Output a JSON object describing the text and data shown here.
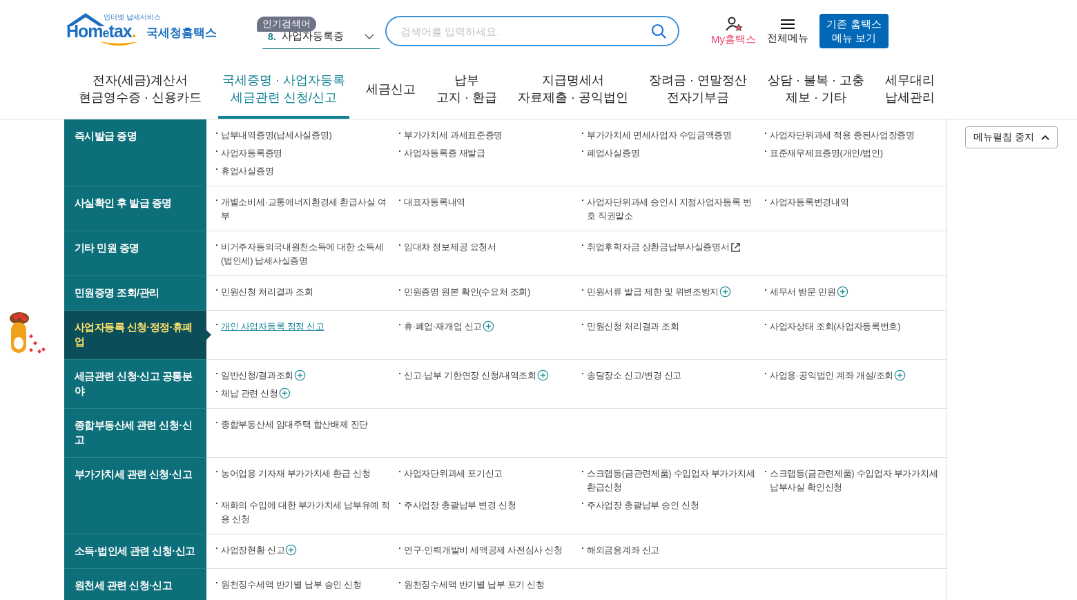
{
  "header": {
    "logo": {
      "tagline": "인터넷 납세서비스",
      "wordmark_parts": [
        "Hom",
        "e",
        "tax",
        "."
      ],
      "name": "국세청홈택스"
    },
    "popular": {
      "badge": "인기검색어",
      "rank": "8.",
      "term": "사업자등록증"
    },
    "search": {
      "placeholder": "검색어를 입력하세요."
    },
    "my": "My홈택스",
    "all_menu": "전체메뉴",
    "legacy_button": [
      "기존 홈택스",
      "메뉴 보기"
    ]
  },
  "nav": [
    {
      "lines": [
        "전자(세금)계산서",
        "현금영수증 · 신용카드"
      ],
      "selected": false
    },
    {
      "lines": [
        "국세증명 · 사업자등록",
        "세금관련 신청/신고"
      ],
      "selected": true
    },
    {
      "lines": [
        "세금신고"
      ],
      "selected": false
    },
    {
      "lines": [
        "납부",
        "고지 · 환급"
      ],
      "selected": false
    },
    {
      "lines": [
        "지급명세서",
        "자료제출 · 공익법인"
      ],
      "selected": false
    },
    {
      "lines": [
        "장려금 · 연말정산",
        "전자기부금"
      ],
      "selected": false
    },
    {
      "lines": [
        "상담 · 불복 · 고충",
        "제보 · 기타"
      ],
      "selected": false
    },
    {
      "lines": [
        "세무대리",
        "납세관리"
      ],
      "selected": false
    }
  ],
  "collapse_button": "메뉴펼침 중지",
  "sections": [
    {
      "title": "즉시발급 증명",
      "selected": false,
      "items": [
        {
          "text": "납부내역증명(납세사실증명)",
          "kind": "plain",
          "selected": false
        },
        {
          "text": "부가가치세 과세표준증명",
          "kind": "plain",
          "selected": false
        },
        {
          "text": "부가가치세 면세사업자 수입금액증명",
          "kind": "plain",
          "selected": false
        },
        {
          "text": "사업자단위과세 적용 종된사업장증명",
          "kind": "plain",
          "selected": false
        },
        {
          "text": "사업자등록증명",
          "kind": "plain",
          "selected": false
        },
        {
          "text": "사업자등록증 재발급",
          "kind": "plain",
          "selected": false
        },
        {
          "text": "폐업사실증명",
          "kind": "plain",
          "selected": false
        },
        {
          "text": "표준재무제표증명(개인/법인)",
          "kind": "plain",
          "selected": false
        },
        {
          "text": "휴업사실증명",
          "kind": "plain",
          "selected": false
        }
      ]
    },
    {
      "title": "사실확인 후 발급 증명",
      "selected": false,
      "items": [
        {
          "text": "개별소비세·교통에너지환경세 환급사실 여부",
          "kind": "plain",
          "selected": false
        },
        {
          "text": "대표자등록내역",
          "kind": "plain",
          "selected": false
        },
        {
          "text": "사업자단위과세 승인시 지점사업자등록 번호 직권말소",
          "kind": "plain",
          "selected": false
        },
        {
          "text": "사업자등록변경내역",
          "kind": "plain",
          "selected": false
        }
      ]
    },
    {
      "title": "기타 민원 증명",
      "selected": false,
      "items": [
        {
          "text": "비거주자등의국내원천소득에 대한 소득세(법인세) 납세사실증명",
          "kind": "plain",
          "selected": false
        },
        {
          "text": "임대차 정보제공 요청서",
          "kind": "plain",
          "selected": false
        },
        {
          "text": "취업후학자금 상환금납부사실증명서",
          "kind": "external",
          "selected": false
        }
      ]
    },
    {
      "title": "민원증명 조회/관리",
      "selected": false,
      "items": [
        {
          "text": "민원신청 처리결과 조회",
          "kind": "plain",
          "selected": false
        },
        {
          "text": "민원증명 원본 확인(수요처 조회)",
          "kind": "plain",
          "selected": false
        },
        {
          "text": "민원서류 발급 제한 및 위변조방지",
          "kind": "plus",
          "selected": false
        },
        {
          "text": "세무서 방문 민원",
          "kind": "plus",
          "selected": false
        }
      ]
    },
    {
      "title": "사업자등록 신청·정정·휴폐업",
      "selected": true,
      "items": [
        {
          "text": "개인 사업자등록 정정 신고",
          "kind": "plain",
          "selected": true
        },
        {
          "text": "휴·폐업·재개업 신고",
          "kind": "plus",
          "selected": false
        },
        {
          "text": "민원신청 처리결과 조회",
          "kind": "plain",
          "selected": false
        },
        {
          "text": "사업자상태 조회(사업자등록번호)",
          "kind": "plain",
          "selected": false
        }
      ]
    },
    {
      "title": "세금관련 신청·신고 공통분야",
      "selected": false,
      "items": [
        {
          "text": "일반신청/결과조회",
          "kind": "plus",
          "selected": false
        },
        {
          "text": "신고·납부 기한연장 신청/내역조회",
          "kind": "plus",
          "selected": false
        },
        {
          "text": "송달장소 신고/변경 신고",
          "kind": "plain",
          "selected": false
        },
        {
          "text": "사업용·공익법인 계좌 개설/조회",
          "kind": "plus",
          "selected": false
        },
        {
          "text": "체납 관련 신청",
          "kind": "plus",
          "selected": false
        }
      ]
    },
    {
      "title": "종합부동산세 관련 신청·신고",
      "selected": false,
      "items": [
        {
          "text": "종합부동산세 임대주택 합산배제 진단",
          "kind": "plain",
          "selected": false
        }
      ]
    },
    {
      "title": "부가가치세 관련 신청·신고",
      "selected": false,
      "items": [
        {
          "text": "농어업용 기자재 부가가치세 환급 신청",
          "kind": "plain",
          "selected": false
        },
        {
          "text": "사업자단위과세 포기신고",
          "kind": "plain",
          "selected": false
        },
        {
          "text": "스크랩등(금관련제품) 수입업자 부가가치세 환급신청",
          "kind": "plain",
          "selected": false
        },
        {
          "text": "스크랩등(금관련제품) 수입업자 부가가치세 납부사실 확인신청",
          "kind": "plain",
          "selected": false
        },
        {
          "text": "재화의 수입에 대한 부가가치세 납부유예 적용 신청",
          "kind": "plain",
          "selected": false
        },
        {
          "text": "주사업장 총괄납부 변경 신청",
          "kind": "plain",
          "selected": false
        },
        {
          "text": "주사업장 총괄납부 승인 신청",
          "kind": "plain",
          "selected": false
        }
      ]
    },
    {
      "title": "소득·법인세 관련 신청·신고",
      "selected": false,
      "items": [
        {
          "text": "사업장현황 신고",
          "kind": "plus",
          "selected": false
        },
        {
          "text": "연구·인력개발비 세액공제 사전심사 신청",
          "kind": "plain",
          "selected": false
        },
        {
          "text": "해외금융계좌 신고",
          "kind": "plain",
          "selected": false
        }
      ]
    },
    {
      "title": "원천세 관련 신청·신고",
      "selected": false,
      "items": [
        {
          "text": "원천징수세액 반기별 납부 승인 신청",
          "kind": "plain",
          "selected": false
        },
        {
          "text": "원천징수세액 반기별 납부 포기 신청",
          "kind": "plain",
          "selected": false
        }
      ]
    }
  ]
}
